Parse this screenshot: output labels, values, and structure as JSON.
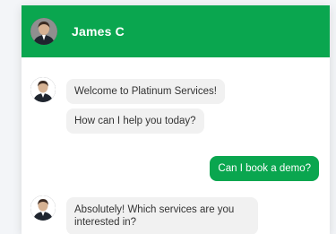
{
  "header": {
    "name": "James C"
  },
  "messages": [
    {
      "from": "agent",
      "text": "Welcome to Platinum Services!"
    },
    {
      "from": "agent",
      "text": "How can I help you today?"
    },
    {
      "from": "user",
      "text": "Can I book a demo?"
    },
    {
      "from": "agent",
      "text": "Absolutely! Which services are you interested in?"
    }
  ],
  "colors": {
    "accent": "#0aa64f",
    "agent_bubble": "#f1f1f1"
  }
}
